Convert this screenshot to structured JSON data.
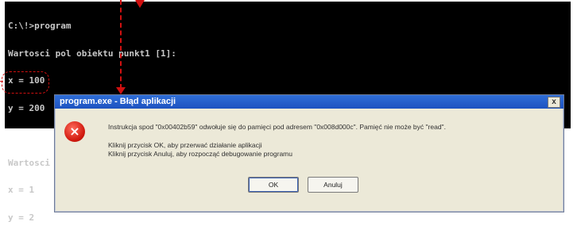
{
  "console": {
    "lines": [
      "C:\\!>program",
      "Wartosci pol obiektu punkt1 [1]:",
      "x = 100",
      "y = 200",
      "",
      "Wartosci pol obiektu punkt1 [2]:",
      "x = 1",
      "y = 2"
    ]
  },
  "dialog": {
    "title": "program.exe - Błąd aplikacji",
    "close_label": "x",
    "icon": "error-icon",
    "icon_glyph": "×",
    "message": "Instrukcja spod \"0x00402b59\" odwołuje się do pamięci pod adresem \"0x008d000c\". Pamięć nie może być \"read\".",
    "hint_ok": "Kliknij przycisk OK, aby przerwać działanie aplikacji",
    "hint_cancel": "Kliknij przycisk Anuluj, aby rozpocząć debugowanie programu",
    "ok_label": "OK",
    "cancel_label": "Anuluj"
  },
  "colors": {
    "annotation": "#d01010",
    "titlebar": "#2460cc",
    "dialog_bg": "#ece9d8"
  }
}
